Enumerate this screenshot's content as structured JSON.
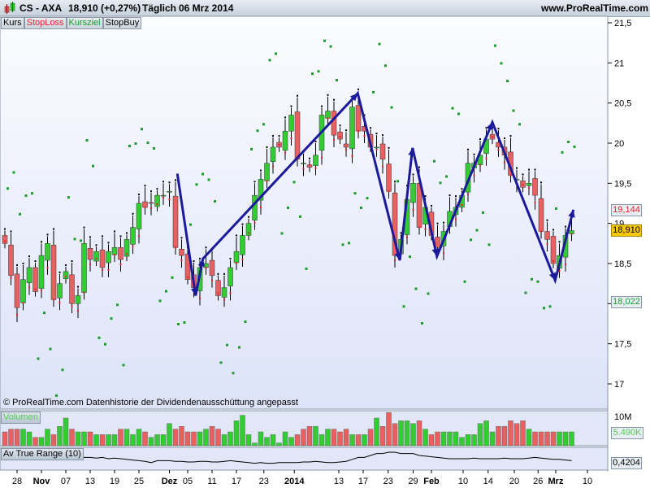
{
  "header": {
    "symbol": "CS - AXA",
    "price": "18,910 (+0,27%)",
    "period": "Täglich",
    "date": "06 Mrz 2014",
    "site": "www.ProRealTime.com"
  },
  "legend": [
    {
      "label": "Kurs",
      "color": "#000000"
    },
    {
      "label": "StopLoss",
      "color": "#e0202a"
    },
    {
      "label": "Kursziel",
      "color": "#1a9a2a"
    },
    {
      "label": "StopBuy",
      "color": "#000000"
    }
  ],
  "footer": "© ProRealTime.com  Datenhistorie der Dividendenausschüttung angepasst",
  "tags": {
    "stopbuy": "19,144",
    "last": "18,910",
    "kursziel": "18,022",
    "volume": "5.490K",
    "volume_scale": "10M",
    "atr": "0,4204"
  },
  "panels": {
    "volume": "Volumen",
    "atr": "Av True Range (10)"
  },
  "chart_data": {
    "type": "candlestick",
    "ylim": [
      16.8,
      21.6
    ],
    "yticks": [
      "17",
      "17,5",
      "18",
      "18,5",
      "19",
      "19,5",
      "20",
      "20,5",
      "21",
      "21,5"
    ],
    "ytick_values": [
      17,
      17.5,
      18,
      18.5,
      19,
      19.5,
      20,
      20.5,
      21,
      21.5
    ],
    "xticks": [
      {
        "label": "28",
        "i": 2
      },
      {
        "label": "Nov",
        "i": 6,
        "bold": true
      },
      {
        "label": "07",
        "i": 10
      },
      {
        "label": "13",
        "i": 14
      },
      {
        "label": "19",
        "i": 18
      },
      {
        "label": "25",
        "i": 22
      },
      {
        "label": "Dez",
        "i": 27,
        "bold": true
      },
      {
        "label": "05",
        "i": 30
      },
      {
        "label": "11",
        "i": 34
      },
      {
        "label": "17",
        "i": 38
      },
      {
        "label": "23",
        "i": 42.5
      },
      {
        "label": "2014",
        "i": 47.5,
        "bold": true
      },
      {
        "label": "13",
        "i": 54.8
      },
      {
        "label": "17",
        "i": 58.8
      },
      {
        "label": "23",
        "i": 62.9
      },
      {
        "label": "29",
        "i": 67
      },
      {
        "label": "Feb",
        "i": 70,
        "bold": true
      },
      {
        "label": "10",
        "i": 75.2
      },
      {
        "label": "14",
        "i": 79.3
      },
      {
        "label": "20",
        "i": 83.6
      },
      {
        "label": "26",
        "i": 87.5
      },
      {
        "label": "Mrz",
        "i": 90.4,
        "bold": true
      },
      {
        "label": "10",
        "i": 95.6
      }
    ],
    "closes": [
      18.75,
      18.35,
      17.95,
      18.3,
      18.45,
      18.15,
      18.6,
      18.75,
      18.05,
      18.25,
      18.4,
      18.0,
      18.1,
      18.75,
      18.55,
      18.65,
      18.45,
      18.65,
      18.7,
      18.55,
      18.8,
      18.95,
      19.25,
      19.2,
      19.25,
      19.35,
      19.35,
      19.4,
      18.7,
      18.6,
      18.3,
      18.2,
      18.45,
      18.5,
      18.35,
      18.1,
      18.2,
      18.45,
      18.65,
      18.85,
      19.0,
      19.35,
      19.55,
      19.75,
      19.95,
      19.95,
      20.15,
      20.35,
      19.8,
      19.75,
      19.7,
      19.85,
      20.35,
      20.4,
      20.1,
      20.05,
      19.95,
      20.45,
      20.15,
      20.15,
      19.95,
      19.95,
      19.8,
      19.4,
      18.6,
      18.8,
      19.3,
      19.5,
      18.95,
      19.2,
      18.85,
      18.7,
      18.9,
      19.15,
      19.2,
      19.35,
      19.75,
      19.75,
      19.85,
      20.05,
      20.05,
      19.95,
      19.85,
      19.6,
      19.55,
      19.45,
      19.5,
      19.35,
      18.9,
      18.8,
      18.5,
      18.6,
      18.85,
      18.91
    ],
    "volumes": [
      5,
      6,
      6,
      6,
      5,
      3,
      3,
      6,
      4,
      7,
      10,
      6,
      5,
      5,
      5,
      4,
      4,
      4,
      4,
      6,
      6,
      4,
      6,
      5,
      3,
      4,
      4,
      8,
      6,
      7,
      5,
      5,
      5,
      6,
      7,
      6,
      4,
      5,
      9,
      11,
      4,
      1,
      5,
      3,
      4,
      1,
      5,
      3,
      4,
      6,
      7,
      7,
      4,
      6,
      6,
      5,
      6,
      4,
      4,
      4,
      6,
      10,
      7,
      12,
      8,
      9,
      9,
      8,
      9,
      6,
      4,
      5,
      5,
      5,
      5,
      3,
      4,
      4,
      8,
      9,
      5,
      7,
      7,
      9,
      8,
      9,
      6,
      5,
      5,
      5,
      5,
      5,
      5,
      5
    ],
    "volume_max": 13,
    "atr": [
      0.43,
      0.45,
      0.47,
      0.48,
      0.48,
      0.47,
      0.45,
      0.47,
      0.47,
      0.49,
      0.5,
      0.49,
      0.49,
      0.47,
      0.47,
      0.46,
      0.47,
      0.45,
      0.46,
      0.45,
      0.44,
      0.43,
      0.42,
      0.41,
      0.39,
      0.42,
      0.42,
      0.42,
      0.41,
      0.41,
      0.4,
      0.4,
      0.41,
      0.41,
      0.4,
      0.4,
      0.41,
      0.42,
      0.41,
      0.4,
      0.39,
      0.38,
      0.39,
      0.38,
      0.38,
      0.39,
      0.39,
      0.39,
      0.39,
      0.4,
      0.4,
      0.41,
      0.4,
      0.39,
      0.39,
      0.4,
      0.41,
      0.44,
      0.47,
      0.47,
      0.5,
      0.53,
      0.53,
      0.55,
      0.55,
      0.53,
      0.53,
      0.53,
      0.5,
      0.49,
      0.48,
      0.47,
      0.46,
      0.45,
      0.45,
      0.45,
      0.45,
      0.46,
      0.45,
      0.45,
      0.45,
      0.45,
      0.46,
      0.45,
      0.45,
      0.45,
      0.46,
      0.47,
      0.46,
      0.45,
      0.44,
      0.44,
      0.43,
      0.42
    ],
    "atr_range": [
      0.3,
      0.6
    ],
    "zigzag": [
      [
        28.3,
        19.62
      ],
      [
        31.3,
        18.1
      ],
      [
        32.5,
        18.56
      ],
      [
        57.9,
        20.62
      ],
      [
        64.8,
        18.54
      ],
      [
        66.9,
        19.94
      ],
      [
        70.9,
        18.59
      ],
      [
        80,
        20.26
      ],
      [
        90.3,
        18.29
      ],
      [
        93.3,
        19.17
      ]
    ],
    "colors": {
      "up": "#33cc33",
      "down": "#e86060",
      "zigzag": "#1a1a9a",
      "kursziel": "#1a9a2a",
      "stoploss": "#e0202a"
    }
  }
}
